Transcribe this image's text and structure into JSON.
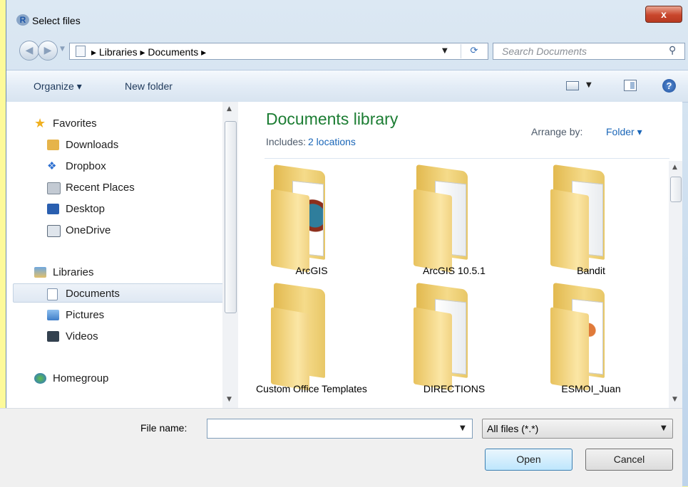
{
  "window": {
    "title": "Select files",
    "close_label": "x"
  },
  "nav": {
    "back_icon": "back-arrow-icon",
    "forward_icon": "forward-arrow-icon"
  },
  "address": {
    "path": "▸ Libraries ▸ Documents ▸",
    "refresh_icon": "refresh-icon"
  },
  "search": {
    "placeholder": "Search Documents"
  },
  "toolbar": {
    "organize_label": "Organize ▾",
    "new_folder_label": "New folder"
  },
  "sidebar": {
    "favorites_label": "Favorites",
    "favorites": [
      {
        "label": "Downloads",
        "icon": "downloads-icon",
        "color": "#e6b44a"
      },
      {
        "label": "Dropbox",
        "icon": "dropbox-icon",
        "color": "#2d6fd0"
      },
      {
        "label": "Recent Places",
        "icon": "recent-places-icon",
        "color": "#7b8794"
      },
      {
        "label": "Desktop",
        "icon": "desktop-icon",
        "color": "#2a5fb0"
      },
      {
        "label": "OneDrive",
        "icon": "onedrive-icon",
        "color": "#5d6b7c"
      }
    ],
    "libraries_label": "Libraries",
    "libraries": [
      {
        "label": "Documents",
        "icon": "documents-icon",
        "selected": true
      },
      {
        "label": "Pictures",
        "icon": "pictures-icon",
        "color": "#3f7ec8"
      },
      {
        "label": "Videos",
        "icon": "videos-icon",
        "color": "#33414f"
      }
    ],
    "homegroup_label": "Homegroup"
  },
  "content": {
    "title": "Documents library",
    "includes_label": "Includes:",
    "includes_link": "2 locations",
    "arrange_label": "Arrange by:",
    "arrange_value": "Folder ▾",
    "folders": [
      {
        "label": "ArcGIS"
      },
      {
        "label": "ArcGIS 10.5.1"
      },
      {
        "label": "Bandit"
      },
      {
        "label": "Custom Office Templates"
      },
      {
        "label": "DIRECTIONS"
      },
      {
        "label": "ESMOI_Juan"
      }
    ]
  },
  "bottom": {
    "file_name_label": "File name:",
    "file_name_value": "",
    "filter_value": "All files (*.*)",
    "open_label": "Open",
    "cancel_label": "Cancel"
  },
  "colors": {
    "library_title": "#1c7d33",
    "link": "#1a66b8",
    "close_button": "#c9462c"
  }
}
